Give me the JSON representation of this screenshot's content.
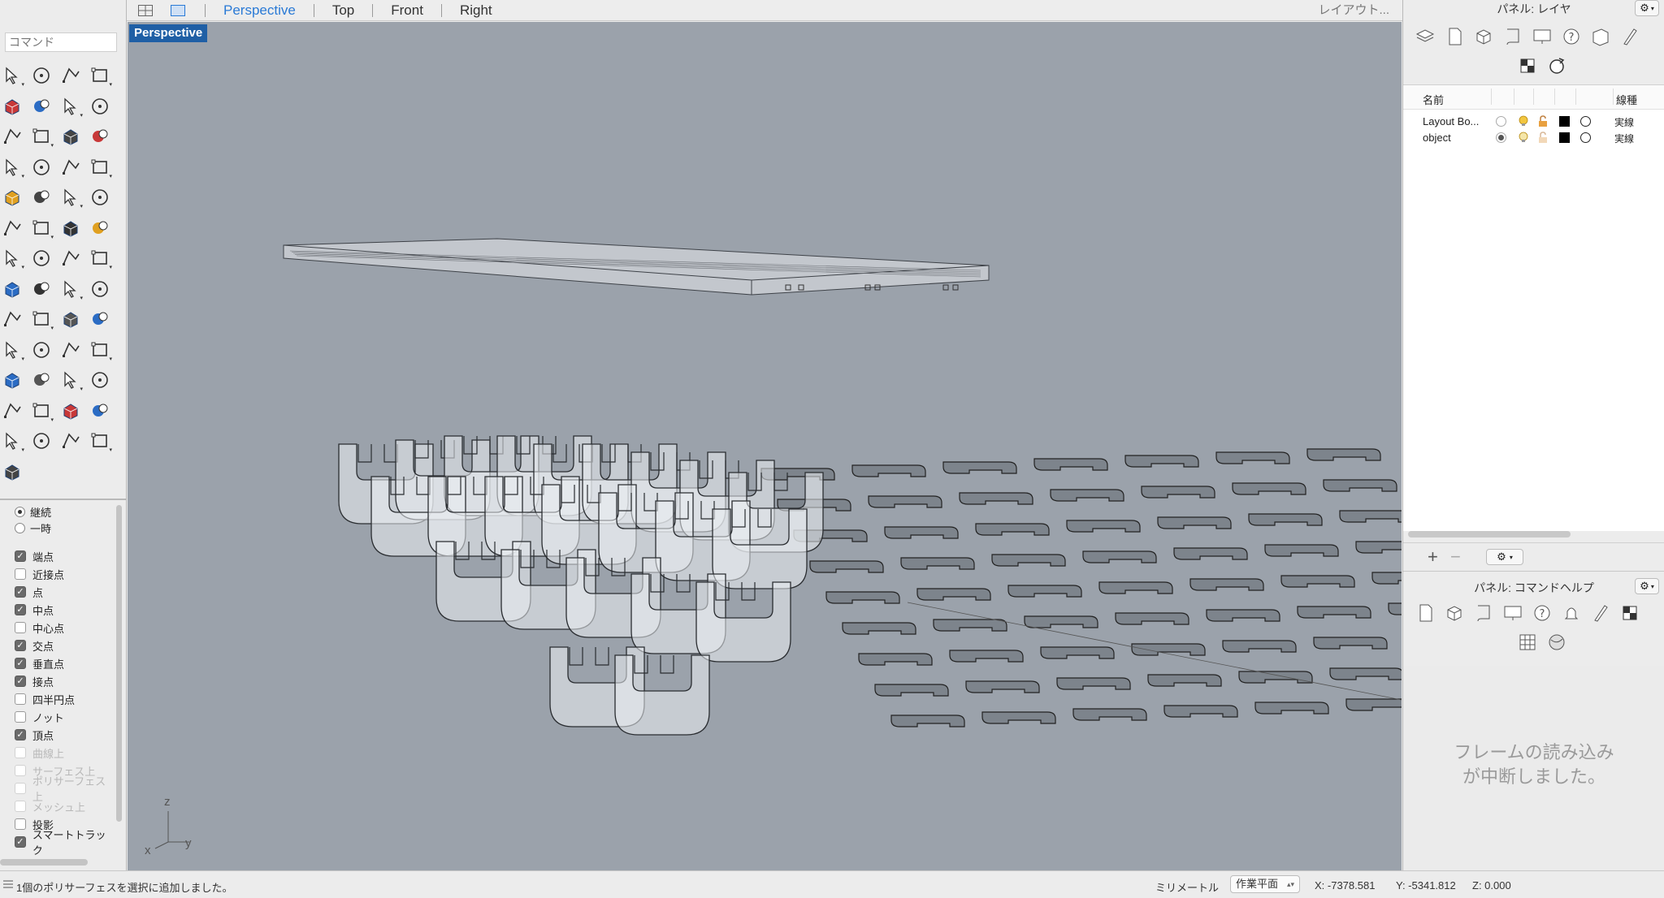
{
  "viewport_tabs": [
    "Perspective",
    "Top",
    "Front",
    "Right"
  ],
  "active_tab": "Perspective",
  "layout_button": "レイアウト...",
  "command_placeholder": "コマンド",
  "viewport": {
    "label": "Perspective",
    "axis": {
      "x": "x",
      "y": "y",
      "z": "z"
    }
  },
  "osnap": {
    "mode_options": [
      {
        "label": "継続",
        "selected": true
      },
      {
        "label": "一時",
        "selected": false
      }
    ],
    "items": [
      {
        "label": "端点",
        "checked": true,
        "enabled": true
      },
      {
        "label": "近接点",
        "checked": false,
        "enabled": true
      },
      {
        "label": "点",
        "checked": true,
        "enabled": true
      },
      {
        "label": "中点",
        "checked": true,
        "enabled": true
      },
      {
        "label": "中心点",
        "checked": false,
        "enabled": true
      },
      {
        "label": "交点",
        "checked": true,
        "enabled": true
      },
      {
        "label": "垂直点",
        "checked": true,
        "enabled": true
      },
      {
        "label": "接点",
        "checked": true,
        "enabled": true
      },
      {
        "label": "四半円点",
        "checked": false,
        "enabled": true
      },
      {
        "label": "ノット",
        "checked": false,
        "enabled": true
      },
      {
        "label": "頂点",
        "checked": true,
        "enabled": true
      },
      {
        "label": "曲線上",
        "checked": false,
        "enabled": false
      },
      {
        "label": "サーフェス上",
        "checked": false,
        "enabled": false
      },
      {
        "label": "ポリサーフェス上",
        "checked": false,
        "enabled": false
      },
      {
        "label": "メッシュ上",
        "checked": false,
        "enabled": false
      },
      {
        "label": "投影",
        "checked": false,
        "enabled": true
      },
      {
        "label": "スマートトラック",
        "checked": true,
        "enabled": true
      }
    ]
  },
  "layer_panel": {
    "title": "パネル: レイヤ",
    "columns": {
      "name": "名前",
      "linetype": "線種"
    },
    "layers": [
      {
        "name": "Layout Bo...",
        "current": false,
        "color": "#000000",
        "linetype": "実線"
      },
      {
        "name": "object",
        "current": true,
        "color": "#000000",
        "linetype": "実線"
      }
    ],
    "add_label": "+",
    "remove_label": "−"
  },
  "help_panel": {
    "title": "パネル: コマンドヘルプ",
    "message_line1": "フレームの読み込み",
    "message_line2": "が中断しました。"
  },
  "statusbar": {
    "message": "1個のポリサーフェスを選択に追加しました。",
    "units": "ミリメートル",
    "cplane": "作業平面",
    "x": "X: -7378.581",
    "y": "Y: -5341.812",
    "z": "Z: 0.000"
  },
  "icons": {
    "left_toolbar": [
      "select-arrow-icon",
      "point-icon",
      "polyline-icon",
      "curve-icon",
      "circle-icon",
      "ellipse-icon",
      "arc-icon",
      "rectangle-icon",
      "polygon-icon",
      "fillet-icon",
      "surface-icon",
      "loft-icon",
      "box-icon",
      "sphere-icon",
      "cylinder-icon",
      "extrude-icon",
      "transform-icon",
      "split-icon",
      "trim-icon",
      "extend-icon",
      "boolean-icon",
      "group-icon",
      "rotate-icon",
      "sweep-icon",
      "text-icon",
      "scale-icon",
      "array-icon",
      "mirror-icon",
      "solid-edit-icon",
      "grid-icon",
      "array-grid-icon",
      "align-icon",
      "analyze-icon",
      "check-icon",
      "shade-icon",
      "light-icon",
      "zoom-icon",
      "zoom-window-icon",
      "zoom-extents-icon",
      "zoom-selected-icon",
      "rotate-view-icon",
      "car-icon",
      "mesh-icon",
      "dimension-icon",
      "bulb-icon",
      "lock-icon",
      "layer-icon",
      "color-wheel-icon",
      "wire-sphere-icon",
      "mesh-sphere-icon",
      "render-sphere-icon",
      "camera-icon",
      "gumball-icon"
    ]
  }
}
